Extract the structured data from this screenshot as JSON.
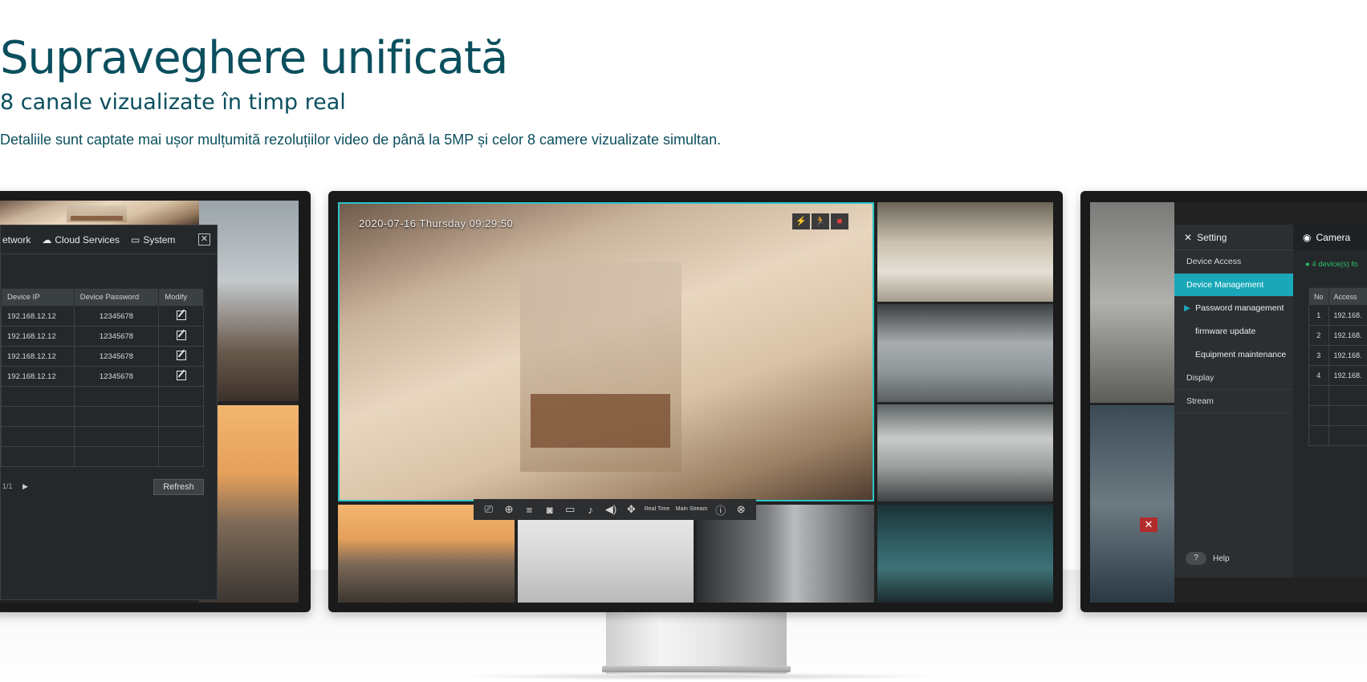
{
  "hero": {
    "title": "Supraveghere unificată",
    "subtitle": "8 canale vizualizate în timp real",
    "description": "Detaliile sunt captate mai ușor mulțumită rezoluțiilor video de până la 5MP și celor 8 camere vizualizate simultan."
  },
  "left_screen": {
    "tabs": [
      "etwork",
      "Cloud Services",
      "System"
    ],
    "close": "✕",
    "columns": [
      "Device IP",
      "Device Password",
      "Modify"
    ],
    "rows": [
      {
        "ip": "192.168.12.12",
        "password": "12345678"
      },
      {
        "ip": "192.168.12.12",
        "password": "12345678"
      },
      {
        "ip": "192.168.12.12",
        "password": "12345678"
      },
      {
        "ip": "192.168.12.12",
        "password": "12345678"
      }
    ],
    "pager": "1/1",
    "refresh": "Refresh"
  },
  "main_screen": {
    "timestamp": "2020-07-16  Thursday 09:29:50",
    "toolbar": {
      "realtime": "Real Time",
      "mainstream": "Main Stream"
    }
  },
  "right_screen": {
    "setting_title": "Setting",
    "camera_tab": "Camera",
    "nav": [
      "Device Access",
      "Device Management",
      "Password management",
      "firmware update",
      "Equipment maintenance",
      "Display",
      "Stream"
    ],
    "device_count": "4 device(s) fo",
    "columns": [
      "No",
      "Access"
    ],
    "rows": [
      {
        "no": "1",
        "access": "192.168."
      },
      {
        "no": "2",
        "access": "192.168."
      },
      {
        "no": "3",
        "access": "192.168."
      },
      {
        "no": "4",
        "access": "192.168."
      }
    ],
    "help": "Help"
  }
}
